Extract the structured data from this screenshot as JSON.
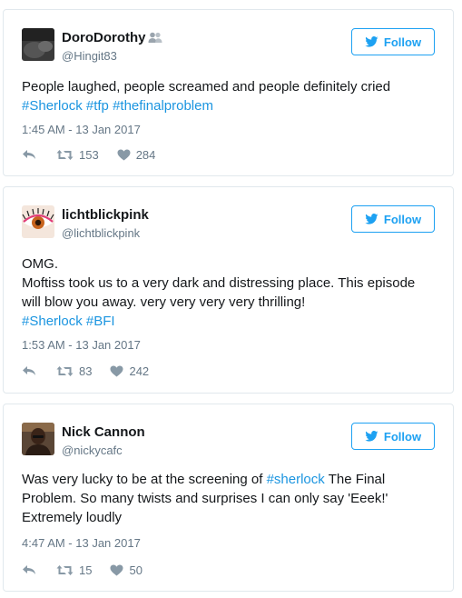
{
  "colors": {
    "link": "#1b95e0",
    "follow": "#1da1f2",
    "muted": "#657786",
    "border": "#e1e8ed"
  },
  "tweets": [
    {
      "name": "DoroDorothy",
      "handle": "@Hingit83",
      "follow_label": "Follow",
      "text_parts": [
        "People laughed, people screamed and people definitely cried",
        "#Sherlock",
        "#tfp",
        "#thefinalproblem"
      ],
      "timestamp": "1:45 AM - 13 Jan 2017",
      "retweets": "153",
      "likes": "284"
    },
    {
      "name": "lichtblickpink",
      "handle": "@lichtblickpink",
      "follow_label": "Follow",
      "text_parts": [
        "OMG.",
        "Moftiss took us to a very dark and distressing place. This episode will blow you away. very very very very thrilling!",
        "#Sherlock",
        "#BFI"
      ],
      "timestamp": "1:53 AM - 13 Jan 2017",
      "retweets": "83",
      "likes": "242"
    },
    {
      "name": "Nick Cannon",
      "handle": "@nickycafc",
      "follow_label": "Follow",
      "text_parts": [
        "Was very lucky to be at the screening of",
        "#sherlock",
        "The Final Problem. So many twists and surprises I can only say 'Eeek!' Extremely loudly"
      ],
      "timestamp": "4:47 AM - 13 Jan 2017",
      "retweets": "15",
      "likes": "50"
    }
  ]
}
